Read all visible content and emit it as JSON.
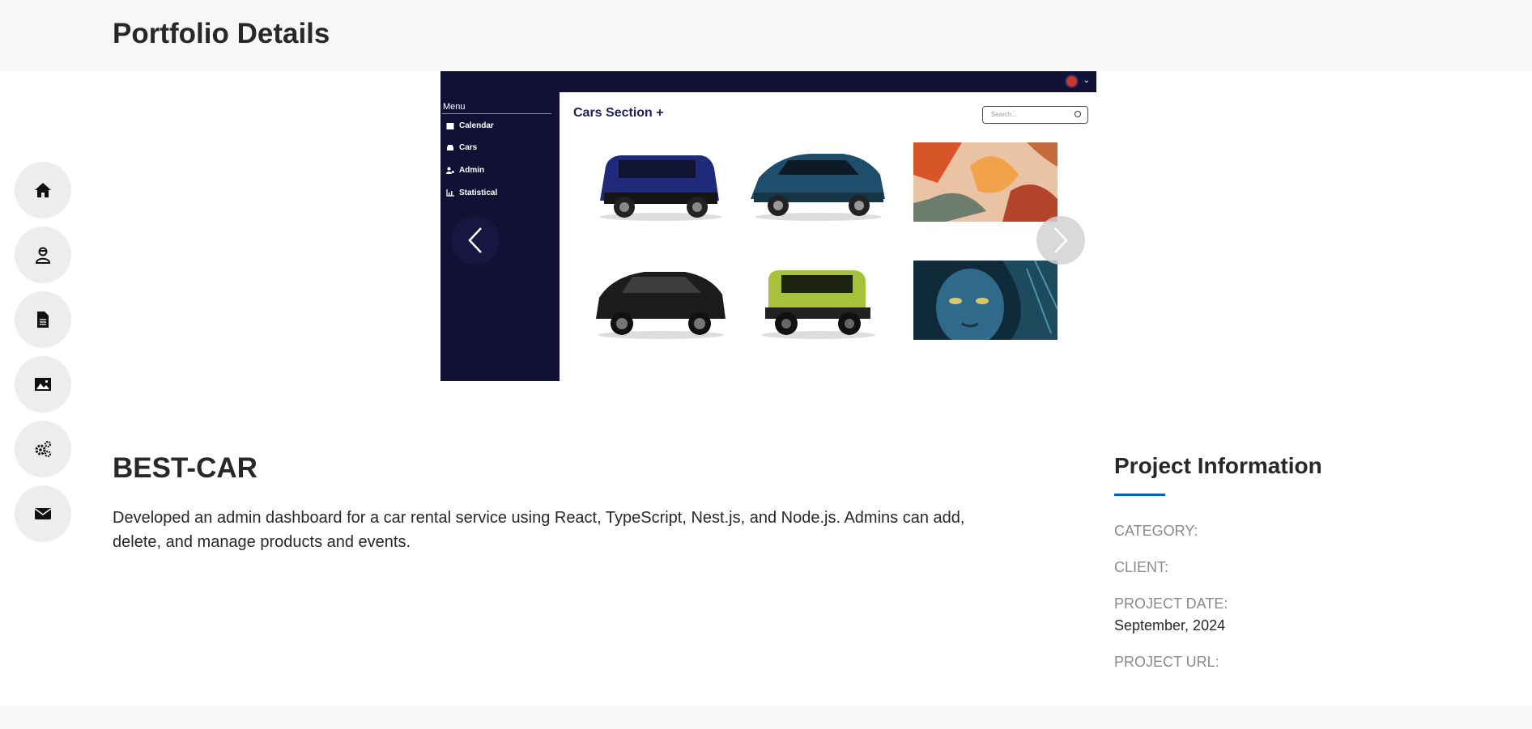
{
  "page": {
    "title": "Portfolio Details"
  },
  "nav": {
    "items": [
      {
        "icon": "home-icon",
        "label": "Home"
      },
      {
        "icon": "user-icon",
        "label": "About"
      },
      {
        "icon": "document-icon",
        "label": "Resume"
      },
      {
        "icon": "image-icon",
        "label": "Portfolio"
      },
      {
        "icon": "gears-icon",
        "label": "Services"
      },
      {
        "icon": "envelope-icon",
        "label": "Contact"
      }
    ]
  },
  "slider": {
    "screenshot": {
      "menu_title": "Menu",
      "menu_items": [
        "Calendar",
        "Cars",
        "Admin",
        "Statistical"
      ],
      "heading": "Cars Section +",
      "search_placeholder": "Search..."
    }
  },
  "project": {
    "name": "BEST-CAR",
    "description": "Developed an admin dashboard for a car rental service using React, TypeScript, Nest.js, and Node.js. Admins can add, delete, and manage products and events."
  },
  "info": {
    "title": "Project Information",
    "category_label": "CATEGORY:",
    "client_label": "CLIENT:",
    "date_label": "PROJECT DATE:",
    "date_value": "September, 2024",
    "url_label": "PROJECT URL:"
  },
  "colors": {
    "accent": "#0563bb",
    "dark_navy": "#111135",
    "topbar_bg": "#f7f7f7",
    "nav_btn_bg": "#ededed"
  }
}
